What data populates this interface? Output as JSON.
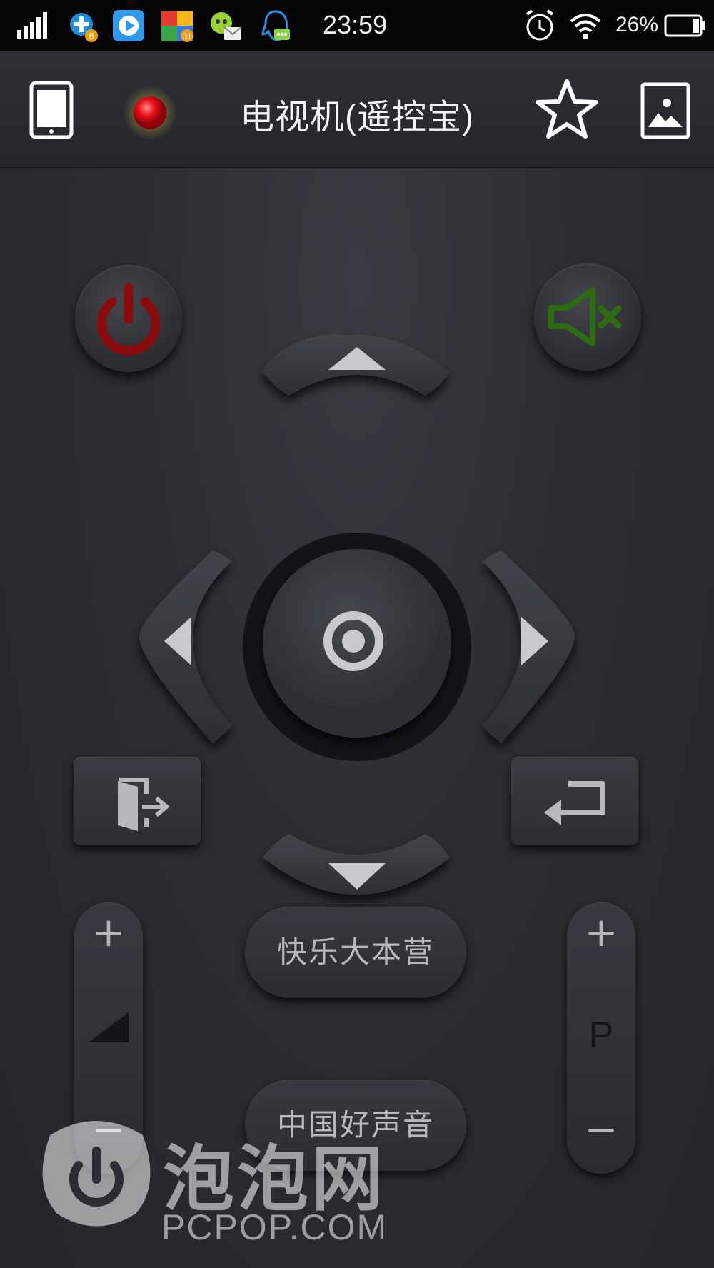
{
  "status_bar": {
    "time": "23:59",
    "battery_percent_label": "26%",
    "notification_icons": [
      "signal-icon",
      "plus-app-icon",
      "video-app-icon",
      "calendar-app-icon",
      "chat-mail-app-icon",
      "qq-app-icon"
    ],
    "calendar_badge": "31",
    "plus_badge": "8"
  },
  "header": {
    "title": "电视机(遥控宝)",
    "indicator_color": "#e8101a"
  },
  "remote": {
    "power_color": "#8a0b0b",
    "mute_color": "#2f6b12",
    "channel_shortcuts": [
      "快乐大本营",
      "中国好声音"
    ],
    "volume": {
      "plus": "+",
      "minus": "−"
    },
    "program": {
      "plus": "+",
      "label": "P",
      "minus": "−"
    }
  },
  "watermark": {
    "brand_cn": "泡泡网",
    "brand_en": "PCPOP.COM"
  }
}
